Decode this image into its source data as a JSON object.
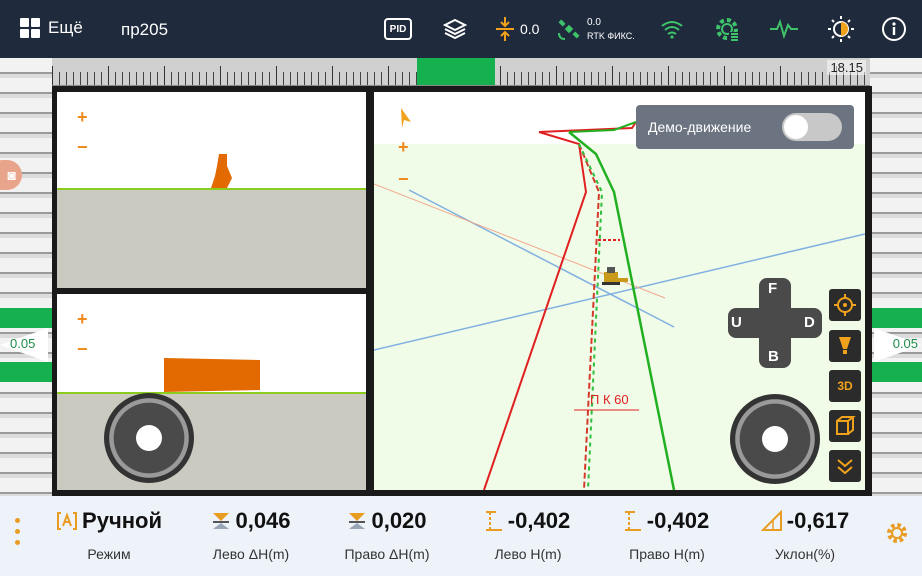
{
  "topbar": {
    "menu_label": "Ещё",
    "project": "пр205",
    "pid_label": "PID",
    "offset_value": "0.0",
    "gnss_value": "0.0",
    "gnss_status": "RTK ФИКС."
  },
  "ruler": {
    "value": "18.15"
  },
  "side": {
    "left_value": "0.05",
    "right_value": "0.05"
  },
  "view3d": {
    "demo_label": "Демо-движение",
    "station_label": "П К 60",
    "dpad": {
      "up": "F",
      "down": "B",
      "left": "U",
      "right": "D"
    },
    "tool_3d_label": "3D"
  },
  "status": {
    "mode": {
      "value": "Ручной",
      "label": "Режим"
    },
    "left_dh": {
      "value": "0,046",
      "label": "Лево ΔH(m)"
    },
    "right_dh": {
      "value": "0,020",
      "label": "Право ΔH(m)"
    },
    "left_h": {
      "value": "-0,402",
      "label": "Лево H(m)"
    },
    "right_h": {
      "value": "-0,402",
      "label": "Право H(m)"
    },
    "slope": {
      "value": "-0,617",
      "label": "Уклон(%)"
    }
  },
  "colors": {
    "accent": "#e89c22",
    "topbar": "#1f2a3c",
    "design_green": "#16b04e",
    "blade": "#e36a00"
  }
}
